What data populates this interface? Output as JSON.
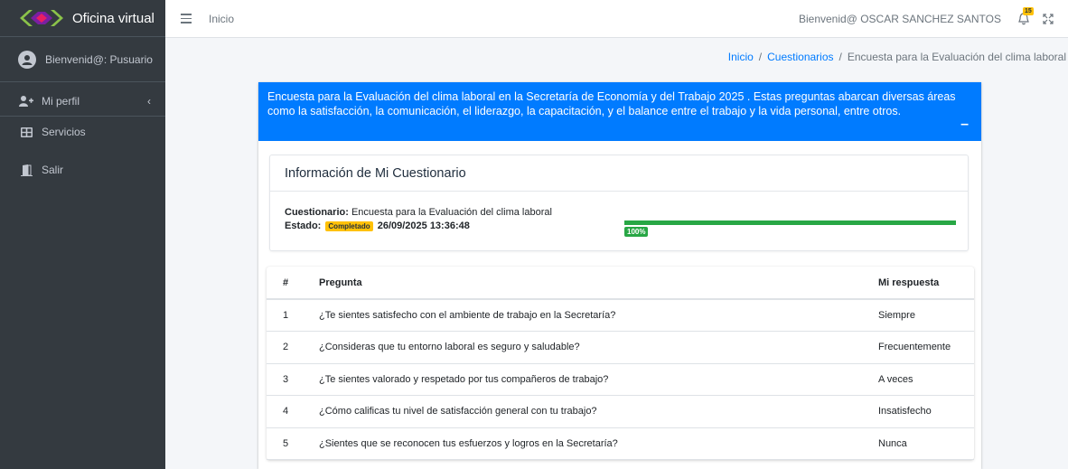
{
  "sidebar": {
    "brand": "Oficina virtual",
    "user": "Bienvenid@: Pusuario",
    "items": [
      {
        "label": "Mi perfil",
        "icon": "user-plus-icon"
      },
      {
        "label": "Servicios",
        "icon": "grid-icon"
      },
      {
        "label": "Salir",
        "icon": "door-icon"
      }
    ]
  },
  "topbar": {
    "home": "Inicio",
    "welcome": "Bienvenid@ OSCAR SANCHEZ SANTOS",
    "notifications": "15"
  },
  "breadcrumb": {
    "home": "Inicio",
    "section": "Cuestionarios",
    "current": "Encuesta para la Evaluación del clima laboral"
  },
  "survey": {
    "description": "Encuesta para la Evaluación del clima laboral en la Secretaría de Economía y del Trabajo 2025 . Estas preguntas abarcan diversas áreas como la satisfacción, la comunicación, el liderazgo, la capacitación, y el balance entre el trabajo y la vida personal, entre otros."
  },
  "info": {
    "title": "Información de Mi Cuestionario",
    "quiz_label": "Cuestionario:",
    "quiz_value": "Encuesta para la Evaluación del clima laboral",
    "status_label": "Estado:",
    "status_badge": "Completado",
    "datetime": "26/09/2025 13:36:48",
    "progress_label": "100%",
    "progress": 1.0
  },
  "table": {
    "headers": [
      "#",
      "Pregunta",
      "Mi respuesta"
    ],
    "rows": [
      {
        "n": "1",
        "q": "¿Te sientes satisfecho con el ambiente de trabajo en la Secretaría?",
        "a": "Siempre"
      },
      {
        "n": "2",
        "q": "¿Consideras que tu entorno laboral es seguro y saludable?",
        "a": "Frecuentemente"
      },
      {
        "n": "3",
        "q": "¿Te sientes valorado y respetado por tus compañeros de trabajo?",
        "a": "A veces"
      },
      {
        "n": "4",
        "q": "¿Cómo calificas tu nivel de satisfacción general con tu trabajo?",
        "a": "Insatisfecho"
      },
      {
        "n": "5",
        "q": "¿Sientes que se reconocen tus esfuerzos y logros en la Secretaría?",
        "a": "Nunca"
      }
    ]
  },
  "colors": {
    "primary": "#007bff",
    "success": "#28a745",
    "warning": "#ffc107",
    "sidebar": "#343a40"
  }
}
